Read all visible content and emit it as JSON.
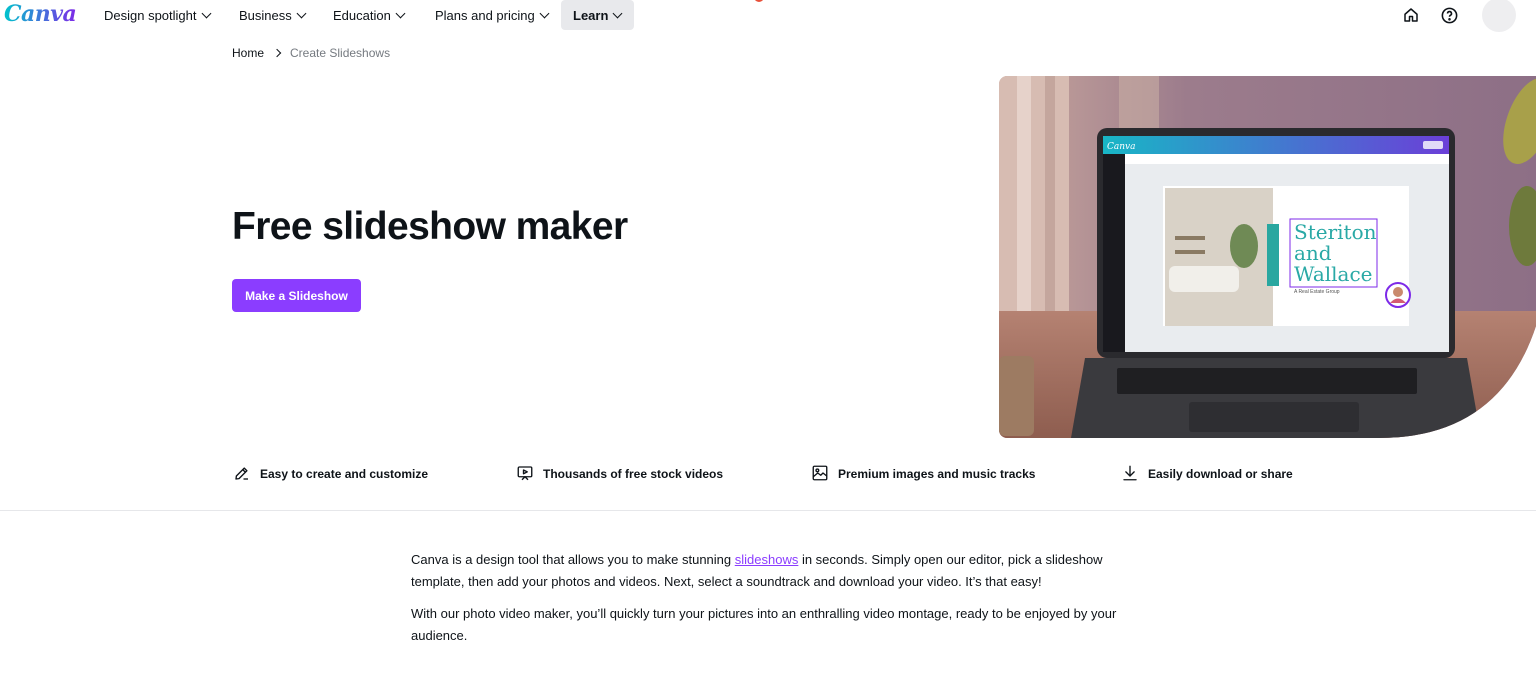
{
  "nav": {
    "logo": "Canva",
    "items": [
      {
        "label": "Design spotlight"
      },
      {
        "label": "Business"
      },
      {
        "label": "Education"
      },
      {
        "label": "Plans and pricing"
      },
      {
        "label": "Learn"
      }
    ],
    "icons": [
      "home-icon",
      "help-icon",
      "avatar"
    ]
  },
  "breadcrumb": {
    "home": "Home",
    "current": "Create Slideshows"
  },
  "hero": {
    "title": "Free slideshow maker",
    "cta": "Make a Slideshow",
    "mockup": {
      "app_logo": "Canva",
      "slide_heading_1": "Steriton",
      "slide_heading_2": "and",
      "slide_heading_3": "Wallace",
      "slide_subtitle": "A Real Estate Group"
    }
  },
  "features": [
    {
      "icon": "edit-icon",
      "label": "Easy to create and customize"
    },
    {
      "icon": "video-icon",
      "label": "Thousands of free stock videos"
    },
    {
      "icon": "image-icon",
      "label": "Premium images and music tracks"
    },
    {
      "icon": "download-icon",
      "label": "Easily download or share"
    }
  ],
  "content": {
    "p1_before": "Canva is a design tool that allows you to make stunning ",
    "p1_link": "slideshows",
    "p1_after": " in seconds. Simply open our editor, pick a slideshow template, then add your photos and videos. Next, select a soundtrack and download your video. It’s that easy!",
    "p2": "With our photo video maker, you’ll quickly turn your pictures into an enthralling video montage, ready to be enjoyed by your audience."
  },
  "colors": {
    "brand_purple": "#8b3dff",
    "text": "#0e1318",
    "muted": "#757a80"
  }
}
